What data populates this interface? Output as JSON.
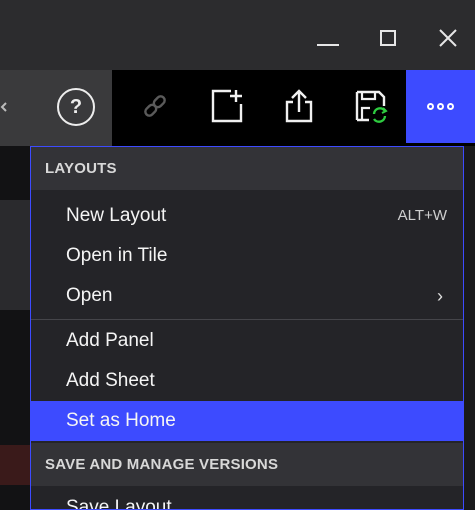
{
  "titlebar": {
    "minimize_icon": "minimize-icon",
    "maximize_icon": "maximize-icon",
    "close_glyph": "✕"
  },
  "toolbar": {
    "help_label": "?",
    "icons": [
      "link-icon",
      "new-layout-icon",
      "share-icon",
      "save-refresh-icon",
      "more-icon"
    ],
    "accent_color": "#3d4bff"
  },
  "menu": {
    "layouts_header": "LAYOUTS",
    "items": [
      {
        "label": "New Layout",
        "shortcut": "ALT+W"
      },
      {
        "label": "Open in Tile"
      },
      {
        "label": "Open",
        "submenu": "›"
      },
      {
        "label": "Add Panel"
      },
      {
        "label": "Add Sheet"
      },
      {
        "label": "Set as Home",
        "highlighted": true
      }
    ],
    "versions_header": "SAVE AND MANAGE VERSIONS",
    "versions_items": [
      {
        "label": "Save Layout"
      }
    ]
  }
}
